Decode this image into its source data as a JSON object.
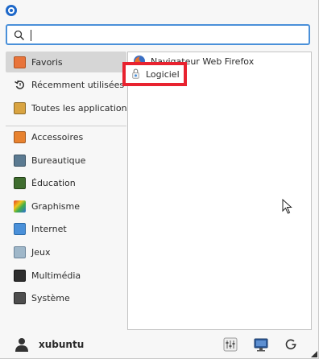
{
  "search": {
    "value": "",
    "placeholder": ""
  },
  "sidebar": {
    "items": [
      {
        "label": "Favoris",
        "icon": "favorites-icon",
        "color": "#e8743b"
      },
      {
        "label": "Récemment utilisées",
        "icon": "recent-icon",
        "color": "#333333"
      },
      {
        "label": "Toutes les applications",
        "icon": "all-apps-icon",
        "color": "#d9a441"
      },
      {
        "label": "Accessoires",
        "icon": "accessories-icon",
        "color": "#e8822f"
      },
      {
        "label": "Bureautique",
        "icon": "office-icon",
        "color": "#5b7a91"
      },
      {
        "label": "Éducation",
        "icon": "education-icon",
        "color": "#3f6d2f"
      },
      {
        "label": "Graphisme",
        "icon": "graphics-icon",
        "color": "#e33b2c"
      },
      {
        "label": "Internet",
        "icon": "internet-icon",
        "color": "#4a90d9"
      },
      {
        "label": "Jeux",
        "icon": "games-icon",
        "color": "#9fb7c9"
      },
      {
        "label": "Multimédia",
        "icon": "multimedia-icon",
        "color": "#2e2e2e"
      },
      {
        "label": "Système",
        "icon": "system-icon",
        "color": "#4d4d4d"
      }
    ]
  },
  "apps": [
    {
      "label": "Navigateur Web Firefox",
      "icon": "firefox-icon"
    },
    {
      "label": "Logiciel",
      "icon": "software-icon"
    }
  ],
  "user": {
    "name": "xubuntu"
  },
  "colors": {
    "accent": "#4a90d9",
    "highlight": "#e8222f",
    "selected": "#d6d6d6"
  }
}
